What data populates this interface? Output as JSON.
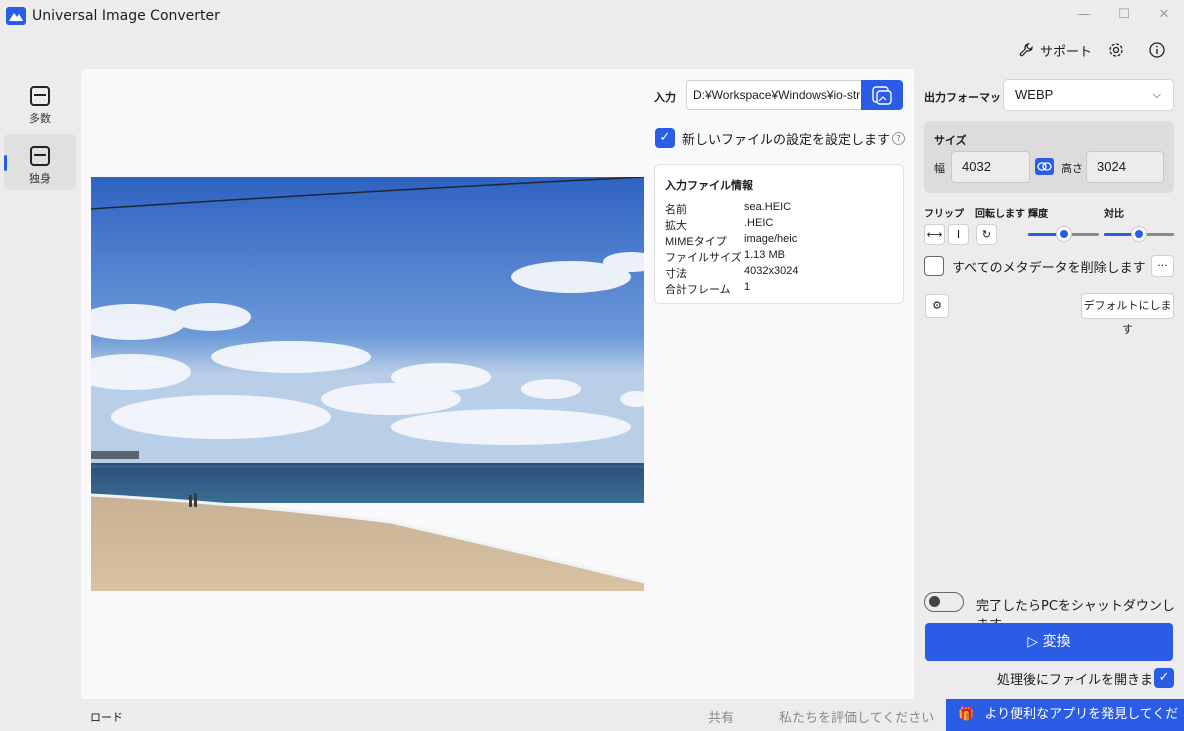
{
  "window": {
    "title": "Universal Image Converter",
    "minimize": "—",
    "maximize": "☐",
    "close": "✕"
  },
  "topbar": {
    "support": "サポート",
    "settings_icon": "gear-icon",
    "info_icon": "info-icon"
  },
  "nav": {
    "items": [
      {
        "label": "多数",
        "icon": "images-icon",
        "active": false
      },
      {
        "label": "独身",
        "icon": "image-icon",
        "active": true
      }
    ]
  },
  "input": {
    "label": "入力",
    "path": "D:¥Workspace¥Windows¥io-str",
    "browse_icon": "browse-images-icon"
  },
  "new_settings": {
    "checked": true,
    "label": "新しいファイルの設定を設定します",
    "help": "?"
  },
  "file_info": {
    "title": "入力ファイル情報",
    "rows": [
      {
        "key": "名前",
        "value": "sea.HEIC"
      },
      {
        "key": "拡大",
        "value": ".HEIC"
      },
      {
        "key": "MIMEタイプ",
        "value": "image/heic"
      },
      {
        "key": "ファイルサイズ",
        "value": "1.13 MB"
      },
      {
        "key": "寸法",
        "value": "4032x3024"
      },
      {
        "key": "合計フレーム",
        "value": "1"
      }
    ]
  },
  "output": {
    "label": "出力フォーマット",
    "format": "WEBP"
  },
  "size": {
    "title": "サイズ",
    "width_label": "幅",
    "width": "4032",
    "height_label": "高さ",
    "height": "3024"
  },
  "transform": {
    "flip_label": "フリップ",
    "rotate_label": "回転します",
    "brightness_label": "輝度",
    "contrast_label": "対比",
    "brightness_value": 0.5,
    "contrast_value": 0.5
  },
  "metadata": {
    "checked": false,
    "label": "すべてのメタデータを削除します",
    "more": "···"
  },
  "defaults": {
    "button": "デフォルトにします"
  },
  "shutdown": {
    "on": false,
    "label": "完了したらPCをシャットダウンします"
  },
  "convert": {
    "label": "▷ 変換"
  },
  "open_after": {
    "checked": true,
    "label": "処理後にファイルを開きます"
  },
  "footer": {
    "load": "ロード",
    "share": "共有",
    "rate": "私たちを評価してください",
    "discover": "より便利なアプリを発見してください"
  },
  "colors": {
    "accent": "#2b5ce6"
  }
}
